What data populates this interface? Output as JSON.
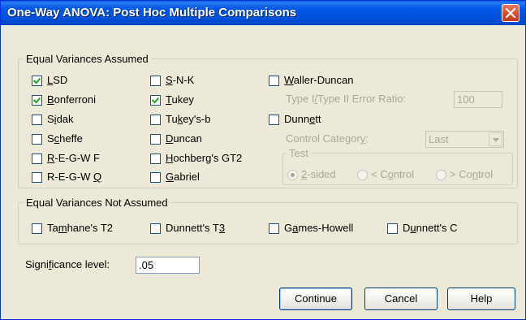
{
  "window": {
    "title": "One-Way ANOVA: Post Hoc Multiple Comparisons"
  },
  "equal_assumed": {
    "legend": "Equal Variances Assumed",
    "checks": [
      {
        "label": "LSD",
        "ul": "L",
        "rest": "SD",
        "pre": "",
        "checked": true
      },
      {
        "label": "Bonferroni",
        "pre": "",
        "ul": "B",
        "rest": "onferroni",
        "checked": true
      },
      {
        "label": "Sidak",
        "pre": "S",
        "ul": "i",
        "rest": "dak",
        "checked": false
      },
      {
        "label": "Scheffe",
        "pre": "S",
        "ul": "c",
        "rest": "heffe",
        "checked": false
      },
      {
        "label": "R-E-G-W F",
        "pre": "",
        "ul": "R",
        "rest": "-E-G-W F",
        "checked": false
      },
      {
        "label": "R-E-G-W Q",
        "pre": "R-E-G-W ",
        "ul": "Q",
        "rest": "",
        "checked": false
      },
      {
        "label": "S-N-K",
        "pre": "",
        "ul": "S",
        "rest": "-N-K",
        "checked": false
      },
      {
        "label": "Tukey",
        "pre": "",
        "ul": "T",
        "rest": "ukey",
        "checked": true
      },
      {
        "label": "Tukey's-b",
        "pre": "Tu",
        "ul": "k",
        "rest": "ey's-b",
        "checked": false
      },
      {
        "label": "Duncan",
        "pre": "",
        "ul": "D",
        "rest": "uncan",
        "checked": false
      },
      {
        "label": "Hochberg's GT2",
        "pre": "",
        "ul": "H",
        "rest": "ochberg's GT2",
        "checked": false
      },
      {
        "label": "Gabriel",
        "pre": "",
        "ul": "G",
        "rest": "abriel",
        "checked": false
      },
      {
        "label": "Waller-Duncan",
        "pre": "",
        "ul": "W",
        "rest": "aller-Duncan",
        "checked": false
      },
      {
        "label": "Dunnett",
        "pre": "Dunn",
        "ul": "e",
        "rest": "tt",
        "checked": false
      }
    ],
    "type_ratio": {
      "label_pre": "Type I",
      "label_ul": "/",
      "label_post": "Type II Error Ratio:",
      "value": "100"
    },
    "control_category": {
      "label_pre": "Control Categor",
      "label_ul": "y",
      "label_post": ":",
      "value": "Last"
    },
    "test": {
      "legend": "Test",
      "options": [
        {
          "pre": "",
          "ul": "2",
          "rest": "-sided",
          "selected": true
        },
        {
          "pre": "< C",
          "ul": "o",
          "rest": "ntrol",
          "selected": false
        },
        {
          "pre": "> Co",
          "ul": "n",
          "rest": "trol",
          "selected": false
        }
      ]
    }
  },
  "equal_not_assumed": {
    "legend": "Equal Variances Not Assumed",
    "checks": [
      {
        "label": "Tamhane's T2",
        "pre": "Ta",
        "ul": "m",
        "rest": "hane's T2",
        "checked": false
      },
      {
        "label": "Dunnett's T3",
        "pre": "Dunnett's T",
        "ul": "3",
        "rest": "",
        "checked": false
      },
      {
        "label": "Games-Howell",
        "pre": "G",
        "ul": "a",
        "rest": "mes-Howell",
        "checked": false
      },
      {
        "label": "Dunnett's C",
        "pre": "D",
        "ul": "u",
        "rest": "nnett's C",
        "checked": false
      }
    ]
  },
  "significance": {
    "label_pre": "Signi",
    "label_ul": "f",
    "label_post": "icance level:",
    "value": ".05"
  },
  "buttons": {
    "continue": "Continue",
    "cancel": "Cancel",
    "help": "Help"
  }
}
